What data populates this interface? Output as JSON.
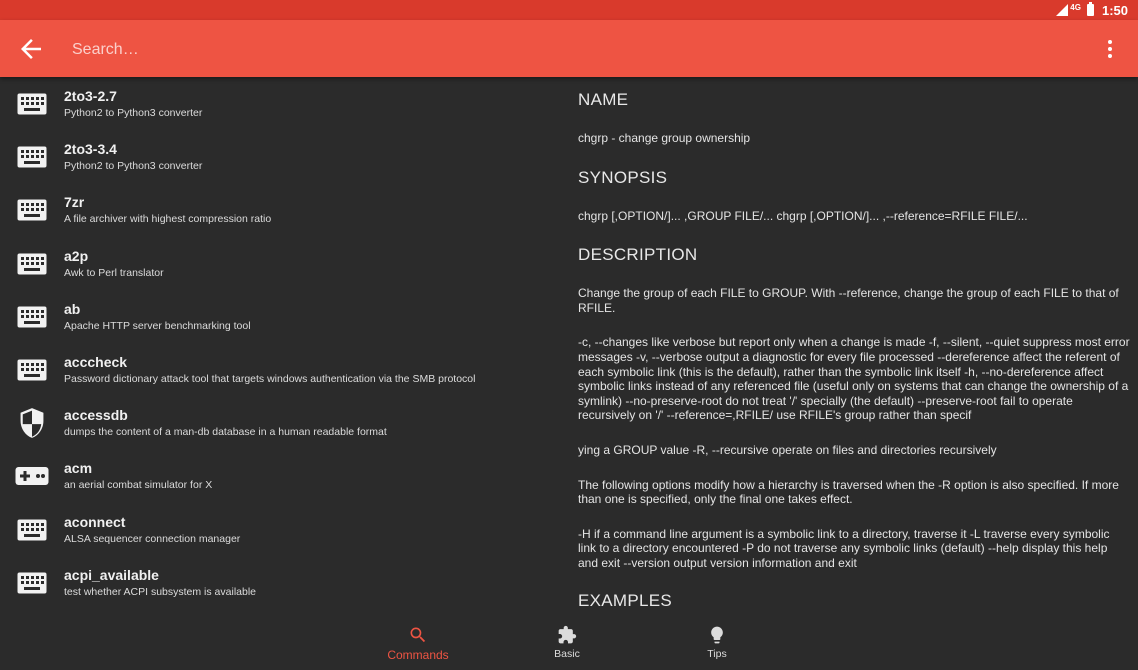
{
  "status": {
    "network": "4G",
    "time": "1:50"
  },
  "search": {
    "placeholder": "Search…",
    "value": ""
  },
  "commands": [
    {
      "name": "2to3-2.7",
      "description": "Python2 to Python3 converter",
      "icon": "keyboard-icon"
    },
    {
      "name": "2to3-3.4",
      "description": "Python2 to Python3 converter",
      "icon": "keyboard-icon"
    },
    {
      "name": "7zr",
      "description": "A file archiver with highest compression ratio",
      "icon": "keyboard-icon"
    },
    {
      "name": "a2p",
      "description": "Awk to Perl translator",
      "icon": "keyboard-icon"
    },
    {
      "name": "ab",
      "description": "Apache HTTP server benchmarking tool",
      "icon": "keyboard-icon"
    },
    {
      "name": "acccheck",
      "description": "Password dictionary attack tool that targets windows authentication via the SMB protocol",
      "icon": "keyboard-icon"
    },
    {
      "name": "accessdb",
      "description": "dumps the content of a man-db database in a human readable format",
      "icon": "shield-icon"
    },
    {
      "name": "acm",
      "description": "an aerial combat simulator for X",
      "icon": "gamepad-icon"
    },
    {
      "name": "aconnect",
      "description": "ALSA sequencer connection manager",
      "icon": "keyboard-icon"
    },
    {
      "name": "acpi_available",
      "description": "test whether ACPI subsystem is available",
      "icon": "keyboard-icon"
    }
  ],
  "detail": {
    "name_title": "NAME",
    "name_text": "chgrp - change group ownership",
    "synopsis_title": "SYNOPSIS",
    "synopsis_text": "chgrp [,OPTION/]... ,GROUP FILE/... chgrp [,OPTION/]... ,--reference=RFILE FILE/...",
    "description_title": "DESCRIPTION",
    "description_paragraphs": [
      "Change the group of each FILE to GROUP. With --reference, change the group of each FILE to that of RFILE.",
      "-c, --changes like verbose but report only when a change is made -f, --silent, --quiet suppress most error messages -v, --verbose output a diagnostic for every file processed --dereference affect the referent of each symbolic link (this is the default), rather than the symbolic link itself -h, --no-dereference affect symbolic links instead of any referenced file (useful only on systems that can change the ownership of a symlink) --no-preserve-root do not treat '/' specially (the default) --preserve-root fail to operate recursively on '/' --reference=,RFILE/ use RFILE's group rather than specif",
      "ying a GROUP value -R, --recursive operate on files and directories recursively",
      "The following options modify how a hierarchy is traversed when the -R option is also specified. If more than one is specified, only the final one takes effect.",
      "-H if a command line argument is a symbolic link to a directory, traverse it -L traverse every symbolic link to a directory encountered -P do not traverse any symbolic links (default) --help display this help and exit --version output version information and exit"
    ],
    "examples_title": "EXAMPLES"
  },
  "bottom_nav": [
    {
      "label": "Commands",
      "icon": "search-icon",
      "active": true
    },
    {
      "label": "Basic",
      "icon": "puzzle-icon",
      "active": false
    },
    {
      "label": "Tips",
      "icon": "lightbulb-icon",
      "active": false
    }
  ],
  "colors": {
    "accent": "#ee5443",
    "statusbar": "#d93a2c",
    "background": "#2b2b2b"
  }
}
